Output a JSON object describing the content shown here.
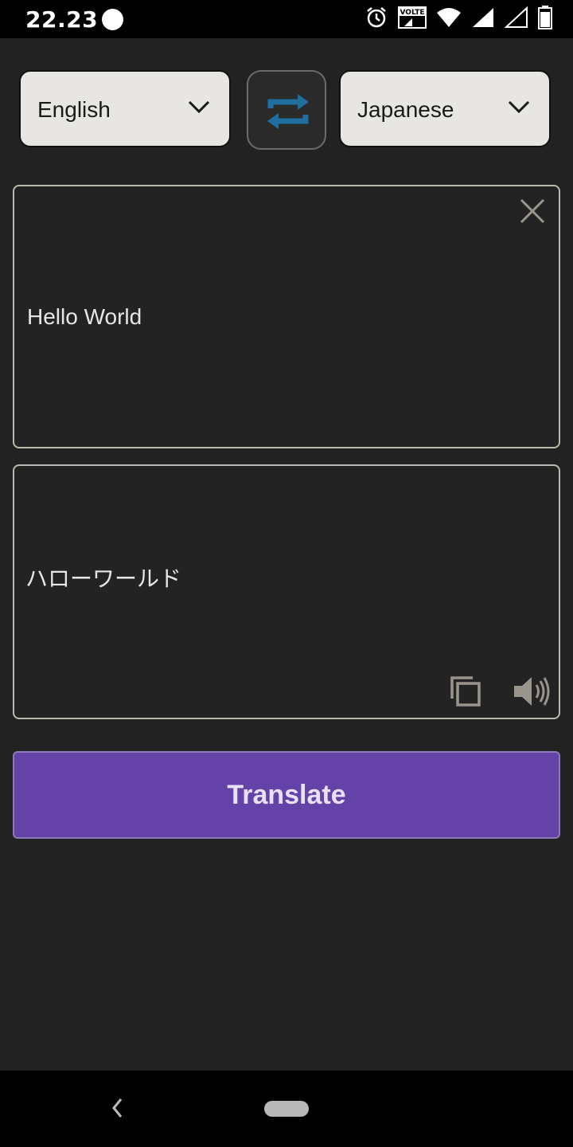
{
  "status_bar": {
    "time": "22.23",
    "icons": [
      "alarm-icon",
      "volte-icon",
      "wifi-icon",
      "signal-icon",
      "signal-empty-icon",
      "battery-icon"
    ],
    "volte_label": "VOLTE"
  },
  "languages": {
    "source": "English",
    "target": "Japanese"
  },
  "input": {
    "text": "Hello World"
  },
  "output": {
    "text": "ハローワールド"
  },
  "translate_button": {
    "label": "Translate"
  },
  "colors": {
    "background": "#222222",
    "accent": "#6542a8",
    "swap_icon": "#1f6fa0"
  }
}
